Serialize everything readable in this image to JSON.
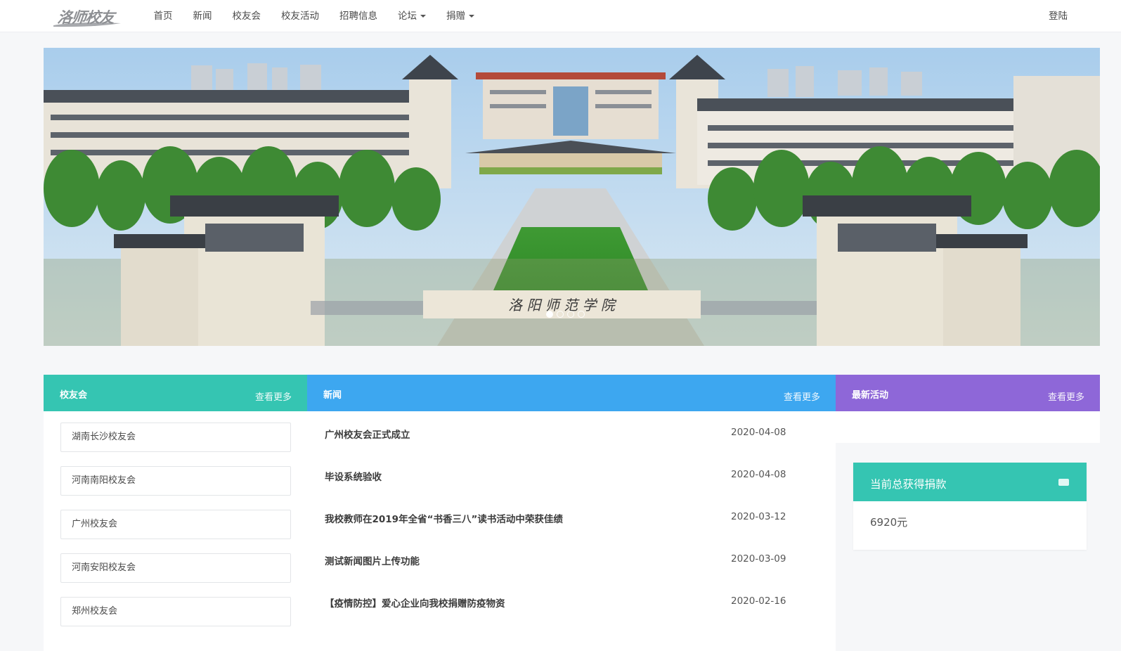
{
  "navbar": {
    "logo_text": "洛师校友",
    "items": [
      {
        "label": "首页"
      },
      {
        "label": "新闻"
      },
      {
        "label": "校友会"
      },
      {
        "label": "校友活动"
      },
      {
        "label": "招聘信息"
      },
      {
        "label": "论坛",
        "dropdown": true
      },
      {
        "label": "捐赠",
        "dropdown": true
      }
    ],
    "login_label": "登陆"
  },
  "banner": {
    "gate_inscription": "洛 阳 师 范 学 院",
    "carousel_total": 4,
    "carousel_active": 1
  },
  "alumni_panel": {
    "title": "校友会",
    "more_label": "查看更多",
    "items": [
      {
        "label": "湖南长沙校友会"
      },
      {
        "label": "河南南阳校友会"
      },
      {
        "label": "广州校友会"
      },
      {
        "label": "河南安阳校友会"
      },
      {
        "label": "郑州校友会"
      }
    ]
  },
  "news_panel": {
    "title": "新闻",
    "more_label": "查看更多",
    "items": [
      {
        "title": "广州校友会正式成立",
        "date": "2020-04-08"
      },
      {
        "title": "毕设系统验收",
        "date": "2020-04-08"
      },
      {
        "title": "我校教师在2019年全省“书香三八”读书活动中荣获佳绩",
        "date": "2020-03-12"
      },
      {
        "title": "测试新闻图片上传功能",
        "date": "2020-03-09"
      },
      {
        "title": "【疫情防控】爱心企业向我校捐赠防疫物资",
        "date": "2020-02-16"
      }
    ]
  },
  "activity_panel": {
    "title": "最新活动",
    "more_label": "查看更多"
  },
  "donation": {
    "title": "当前总获得捐款",
    "icon": "ticket-icon",
    "amount": "6920元"
  },
  "colors": {
    "green": "#35c5b2",
    "blue": "#3da7f0",
    "purple": "#8e67d8"
  }
}
